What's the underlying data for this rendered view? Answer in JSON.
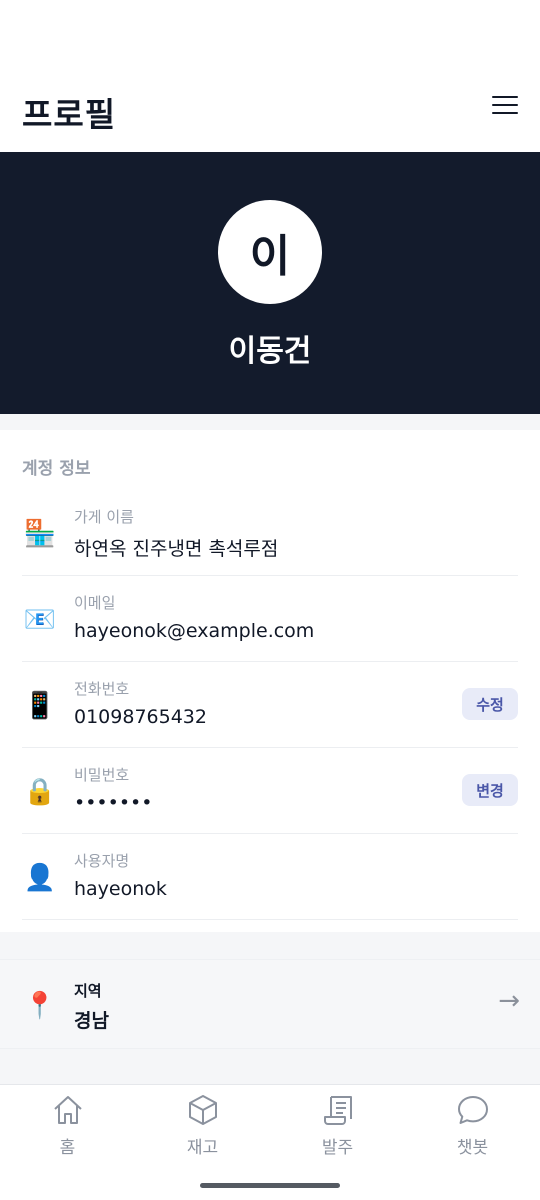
{
  "header": {
    "title": "프로필",
    "menu_icon": "hamburger-menu-icon"
  },
  "profile": {
    "avatar_initial": "이",
    "name": "이동건"
  },
  "account": {
    "section_title": "계정 정보",
    "rows": [
      {
        "icon": "convenience-store-icon",
        "icon_glyph": "🏪",
        "label": "가게 이름",
        "value": "하연옥 진주냉면 촉석루점"
      },
      {
        "icon": "email-icon",
        "icon_glyph": "📧",
        "label": "이메일",
        "value": "hayeonok@example.com"
      },
      {
        "icon": "mobile-phone-icon",
        "icon_glyph": "📱",
        "label": "전화번호",
        "value": "01098765432",
        "action": "수정"
      },
      {
        "icon": "lock-icon",
        "icon_glyph": "🔒",
        "label": "비밀번호",
        "value": "•••••••",
        "action": "변경"
      },
      {
        "icon": "user-icon",
        "icon_glyph": "👤",
        "label": "사용자명",
        "value": "hayeonok"
      }
    ]
  },
  "region": {
    "icon": "location-pin-icon",
    "icon_glyph": "📍",
    "label": "지역",
    "value": "경남",
    "arrow": "→"
  },
  "tabbar": {
    "tabs": [
      {
        "label": "홈",
        "icon": "home-icon"
      },
      {
        "label": "재고",
        "icon": "box-icon"
      },
      {
        "label": "발주",
        "icon": "receipt-icon"
      },
      {
        "label": "챗봇",
        "icon": "chat-bubble-icon"
      }
    ]
  },
  "colors": {
    "hero_bg": "#131b2c",
    "action_bg": "#e8ebf8",
    "action_text": "#4a57a8",
    "muted_text": "#9aa1ad"
  }
}
